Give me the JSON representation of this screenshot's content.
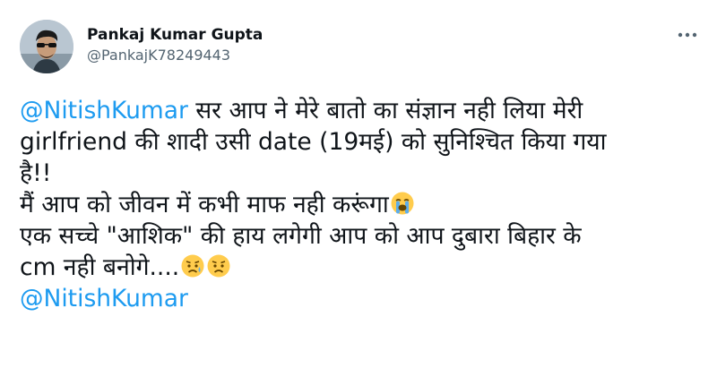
{
  "author": {
    "display_name": "Pankaj Kumar Gupta",
    "handle": "@PankajK78249443",
    "avatar_icon": "profile-photo"
  },
  "more_icon": "more-horizontal-icon",
  "colors": {
    "mention": "#1d9bf0",
    "text": "#0f1419",
    "secondary": "#536471"
  },
  "tweet": {
    "line1_mention": "@NitishKumar",
    "line1_text": " सर आप ने मेरे बातो का संज्ञान नही लिया मेरी",
    "line2_text": "girlfriend की शादी उसी date (19मई) को सुनिश्चित किया गया",
    "line3_text": "है!!",
    "line4_text": "मैं आप को जीवन में कभी माफ नही करूंगा",
    "line5_text": "एक सच्चे \"आशिक\" की हाय लगेगी आप को आप दुबारा बिहार के",
    "line6_text": "cm नही बनोगे....",
    "line7_mention": "@NitishKumar"
  },
  "emojis": {
    "line4": "loudly-crying-face",
    "line6": [
      "disappointed-relieved-face",
      "sad-relieved-face"
    ]
  }
}
